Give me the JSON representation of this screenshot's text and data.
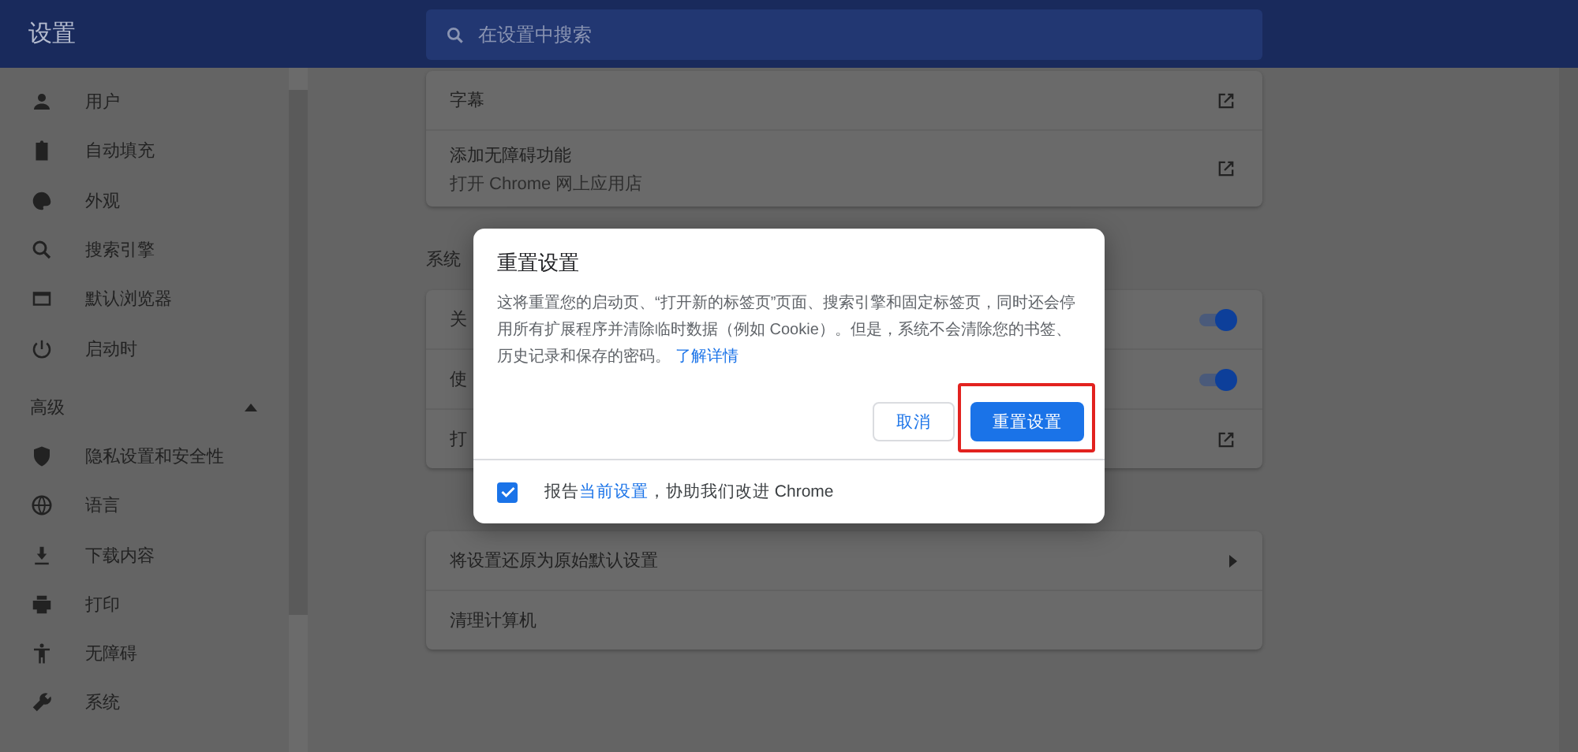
{
  "header": {
    "title": "设置"
  },
  "search": {
    "placeholder": "在设置中搜索"
  },
  "sidebar": {
    "items": [
      {
        "label": "用户",
        "kind": "person"
      },
      {
        "label": "自动填充",
        "kind": "clipboard"
      },
      {
        "label": "外观",
        "kind": "palette"
      },
      {
        "label": "搜索引擎",
        "kind": "search"
      },
      {
        "label": "默认浏览器",
        "kind": "browser"
      },
      {
        "label": "启动时",
        "kind": "power"
      }
    ],
    "advanced": {
      "label": "高级",
      "expanded": true,
      "items": [
        {
          "label": "隐私设置和安全性",
          "kind": "shield"
        },
        {
          "label": "语言",
          "kind": "globe"
        },
        {
          "label": "下载内容",
          "kind": "download"
        },
        {
          "label": "打印",
          "kind": "printer"
        },
        {
          "label": "无障碍",
          "kind": "accessibility"
        },
        {
          "label": "系统",
          "kind": "wrench"
        }
      ]
    }
  },
  "sections": [
    {
      "rows": [
        {
          "title": "字幕",
          "kind": "external"
        },
        {
          "title": "添加无障碍功能",
          "subtitle": "打开 Chrome 网上应用店",
          "kind": "external"
        }
      ]
    },
    {
      "heading": "系统",
      "rows": [
        {
          "title": "关",
          "kind": "toggle",
          "on": true
        },
        {
          "title": "使",
          "kind": "toggle",
          "on": true
        },
        {
          "title": "打",
          "kind": "external"
        }
      ]
    },
    {
      "rows": [
        {
          "title": "将设置还原为原始默认设置",
          "kind": "arrow"
        },
        {
          "title": "清理计算机",
          "kind": "plain"
        }
      ]
    }
  ],
  "dialog": {
    "title": "重置设置",
    "body": "这将重置您的启动页、“打开新的标签页”页面、搜索引擎和固定标签页，同时还会停用所有扩展程序并清除临时数据（例如 Cookie）。但是，系统不会清除您的书签、历史记录和保存的密码。",
    "link": "了解详情",
    "buttons": [
      {
        "label": "取消",
        "kind": "secondary"
      },
      {
        "label": "重置设置",
        "kind": "primary"
      }
    ],
    "footer": {
      "checked": true,
      "before": "报告",
      "link": "当前设置",
      "after": "，协助我们改进 Chrome"
    }
  }
}
